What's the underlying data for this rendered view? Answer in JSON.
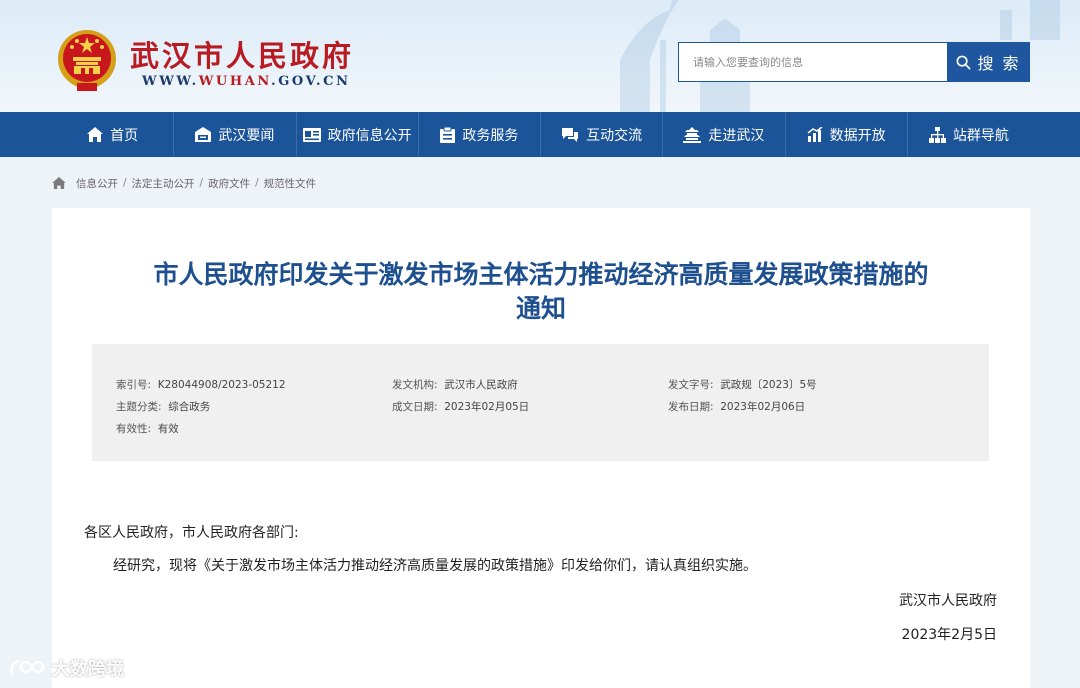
{
  "header": {
    "site_title": "武汉市人民政府",
    "site_url_prefix": "WWW.",
    "site_url_highlight": "WUHAN",
    "site_url_suffix": ".GOV.CN",
    "search_placeholder": "请输入您要查询的信息",
    "search_button": "搜 索"
  },
  "nav": {
    "items": [
      {
        "label": "首页",
        "icon": "home-icon"
      },
      {
        "label": "武汉要闻",
        "icon": "news-icon"
      },
      {
        "label": "政府信息公开",
        "icon": "info-icon"
      },
      {
        "label": "政务服务",
        "icon": "service-icon"
      },
      {
        "label": "互动交流",
        "icon": "chat-icon"
      },
      {
        "label": "走进武汉",
        "icon": "landmark-icon"
      },
      {
        "label": "数据开放",
        "icon": "chart-icon"
      },
      {
        "label": "站群导航",
        "icon": "sitemap-icon"
      }
    ]
  },
  "breadcrumb": {
    "items": [
      "信息公开",
      "法定主动公开",
      "政府文件",
      "规范性文件"
    ],
    "separator": "/"
  },
  "document": {
    "title": "市人民政府印发关于激发市场主体活力推动经济高质量发展政策措施的通知",
    "meta": {
      "index_label": "索引号:",
      "index_value": "K28044908/2023-05212",
      "issuer_label": "发文机构:",
      "issuer_value": "武汉市人民政府",
      "doc_no_label": "发文字号:",
      "doc_no_value": "武政规〔2023〕5号",
      "topic_label": "主题分类:",
      "topic_value": "综合政务",
      "created_label": "成文日期:",
      "created_value": "2023年02月05日",
      "published_label": "发布日期:",
      "published_value": "2023年02月06日",
      "validity_label": "有效性:",
      "validity_value": "有效"
    },
    "salutation": "各区人民政府，市人民政府各部门:",
    "paragraph": "经研究，现将《关于激发市场主体活力推动经济高质量发展的政策措施》印发给你们，请认真组织实施。",
    "signature": "武汉市人民政府",
    "date": "2023年2月5日"
  },
  "watermark": {
    "text": "大数跨境"
  },
  "colors": {
    "nav_bg": "#1b5499",
    "title_red": "#b81c22",
    "doc_title_blue": "#1e4f8f",
    "search_blue": "#1f56a0"
  }
}
